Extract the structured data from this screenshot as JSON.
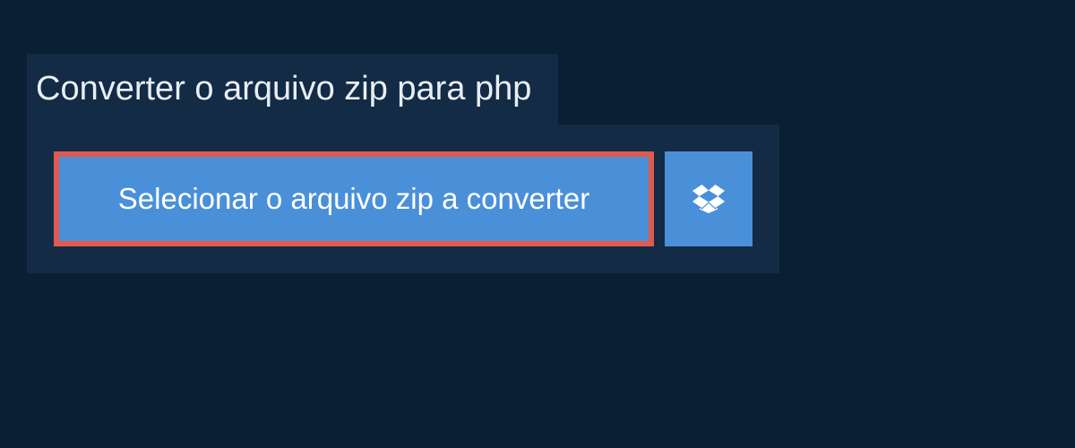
{
  "title": "Converter o arquivo zip para php",
  "selectButton": {
    "label": "Selecionar o arquivo zip a converter"
  },
  "dropboxButton": {
    "iconName": "dropbox-icon"
  },
  "colors": {
    "background": "#0a1f33",
    "panel": "#132b45",
    "buttonBg": "#4a90d9",
    "highlightBorder": "#e05a4f",
    "text": "#ffffff"
  }
}
